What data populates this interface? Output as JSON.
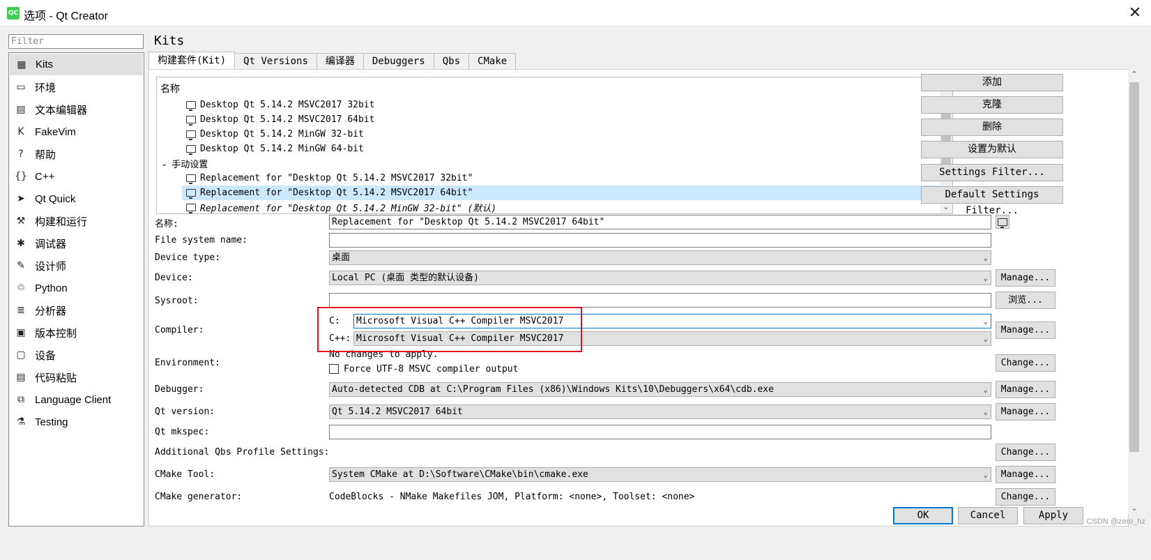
{
  "window": {
    "title": "选项 - Qt Creator",
    "icon_text": "QC",
    "close_glyph": "✕"
  },
  "filter": {
    "placeholder": "Filter"
  },
  "nav": {
    "items": [
      {
        "label": "Kits",
        "icon": "kits-icon",
        "glyph": "▦",
        "selected": true
      },
      {
        "label": "环境",
        "icon": "monitor-icon",
        "glyph": "▭"
      },
      {
        "label": "文本编辑器",
        "icon": "text-editor-icon",
        "glyph": "▤"
      },
      {
        "label": "FakeVim",
        "icon": "fakevim-icon",
        "glyph": "K"
      },
      {
        "label": "帮助",
        "icon": "help-icon",
        "glyph": "?"
      },
      {
        "label": "C++",
        "icon": "cpp-icon",
        "glyph": "{}"
      },
      {
        "label": "Qt Quick",
        "icon": "qt-quick-icon",
        "glyph": "➤"
      },
      {
        "label": "构建和运行",
        "icon": "hammer-icon",
        "glyph": "⚒"
      },
      {
        "label": "调试器",
        "icon": "bug-icon",
        "glyph": "✱"
      },
      {
        "label": "设计师",
        "icon": "pen-icon",
        "glyph": "✎"
      },
      {
        "label": "Python",
        "icon": "python-icon",
        "glyph": "♲"
      },
      {
        "label": "分析器",
        "icon": "analyzer-icon",
        "glyph": "≣"
      },
      {
        "label": "版本控制",
        "icon": "version-control-icon",
        "glyph": "▣"
      },
      {
        "label": "设备",
        "icon": "device-icon",
        "glyph": "▢"
      },
      {
        "label": "代码粘贴",
        "icon": "code-paste-icon",
        "glyph": "▤"
      },
      {
        "label": "Language Client",
        "icon": "language-client-icon",
        "glyph": "⧉"
      },
      {
        "label": "Testing",
        "icon": "testing-icon",
        "glyph": "⚗"
      }
    ]
  },
  "page": {
    "title": "Kits"
  },
  "tabs": [
    {
      "label": "构建套件(Kit)",
      "active": true
    },
    {
      "label": "Qt Versions"
    },
    {
      "label": "编译器"
    },
    {
      "label": "Debuggers"
    },
    {
      "label": "Qbs"
    },
    {
      "label": "CMake"
    }
  ],
  "kit_list": {
    "header": "名称",
    "group_manual": "手动设置",
    "auto_items": [
      "Desktop Qt 5.14.2 MSVC2017 32bit",
      "Desktop Qt 5.14.2 MSVC2017 64bit",
      "Desktop Qt 5.14.2 MinGW 32-bit",
      "Desktop Qt 5.14.2 MinGW 64-bit"
    ],
    "manual_items": [
      "Replacement for \"Desktop Qt 5.14.2 MSVC2017 32bit\"",
      "Replacement for \"Desktop Qt 5.14.2 MSVC2017 64bit\"",
      "Replacement for \"Desktop Qt 5.14.2 MinGW 32-bit\" (默认)"
    ]
  },
  "side_buttons": {
    "add": "添加",
    "clone": "克隆",
    "remove": "删除",
    "make_default": "设置为默认",
    "settings_filter": "Settings Filter...",
    "default_settings_filter": "Default Settings Filter..."
  },
  "form": {
    "name_label": "名称:",
    "name_value": "Replacement for \"Desktop Qt 5.14.2 MSVC2017 64bit\"",
    "fs_name_label": "File system name:",
    "fs_name_value": "",
    "device_type_label": "Device type:",
    "device_type_value": "桌面",
    "device_label": "Device:",
    "device_value": "Local PC (桌面 类型的默认设备)",
    "sysroot_label": "Sysroot:",
    "sysroot_value": "",
    "compiler_label": "Compiler:",
    "compiler_c_label": "C:",
    "compiler_c_value": "Microsoft Visual C++ Compiler MSVC2017",
    "compiler_cpp_label": "C++:",
    "compiler_cpp_value": "Microsoft Visual C++ Compiler MSVC2017",
    "environment_label": "Environment:",
    "environment_value": "No changes to apply.",
    "utf8_label": "Force UTF-8 MSVC compiler output",
    "utf8_checked": false,
    "debugger_label": "Debugger:",
    "debugger_value": "Auto-detected CDB at C:\\Program Files (x86)\\Windows Kits\\10\\Debuggers\\x64\\cdb.exe",
    "qt_version_label": "Qt version:",
    "qt_version_value": "Qt 5.14.2 MSVC2017 64bit",
    "qt_mkspec_label": "Qt mkspec:",
    "qt_mkspec_value": "",
    "qbs_label": "Additional Qbs Profile Settings:",
    "cmake_tool_label": "CMake Tool:",
    "cmake_tool_value": "System CMake at D:\\Software\\CMake\\bin\\cmake.exe",
    "cmake_gen_label": "CMake generator:",
    "cmake_gen_value": "CodeBlocks - NMake Makefiles JOM, Platform: <none>, Toolset: <none>"
  },
  "action_buttons": {
    "manage": "Manage...",
    "browse": "浏览...",
    "change": "Change..."
  },
  "dialog_buttons": {
    "ok": "OK",
    "cancel": "Cancel",
    "apply": "Apply"
  },
  "watermark": "CSDN @zero_hz",
  "colors": {
    "selection": "#cce8ff",
    "focus_border": "#0078d7",
    "annotation": "#e81123"
  }
}
